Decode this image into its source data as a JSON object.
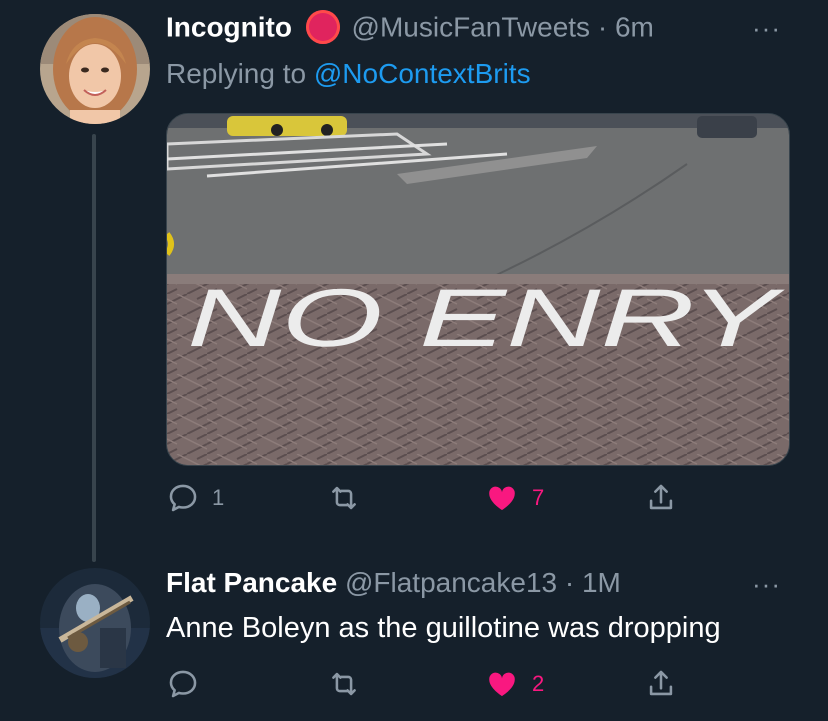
{
  "tweets": [
    {
      "display_name": "Incognito",
      "handle": "@MusicFanTweets",
      "separator": "·",
      "time": "6m",
      "replying_prefix": "Replying to",
      "replying_to": "@NoContextBrits",
      "image_text": "NO ENRY",
      "actions": {
        "reply": "1",
        "retweet": "",
        "like": "7"
      }
    },
    {
      "display_name": "Flat Pancake",
      "handle": "@Flatpancake13",
      "separator": "·",
      "time": "1M",
      "text": "Anne Boleyn as the guillotine was dropping",
      "actions": {
        "reply": "",
        "retweet": "",
        "like": "2"
      }
    }
  ],
  "more_icon": "···",
  "colors": {
    "background": "#15202b",
    "secondary_text": "#8b98a5",
    "link": "#1d9bf0",
    "like": "#f91880",
    "badge": "#e0245e"
  },
  "icons": [
    "reply-icon",
    "retweet-icon",
    "like-heart-icon",
    "share-icon",
    "more-icon"
  ]
}
